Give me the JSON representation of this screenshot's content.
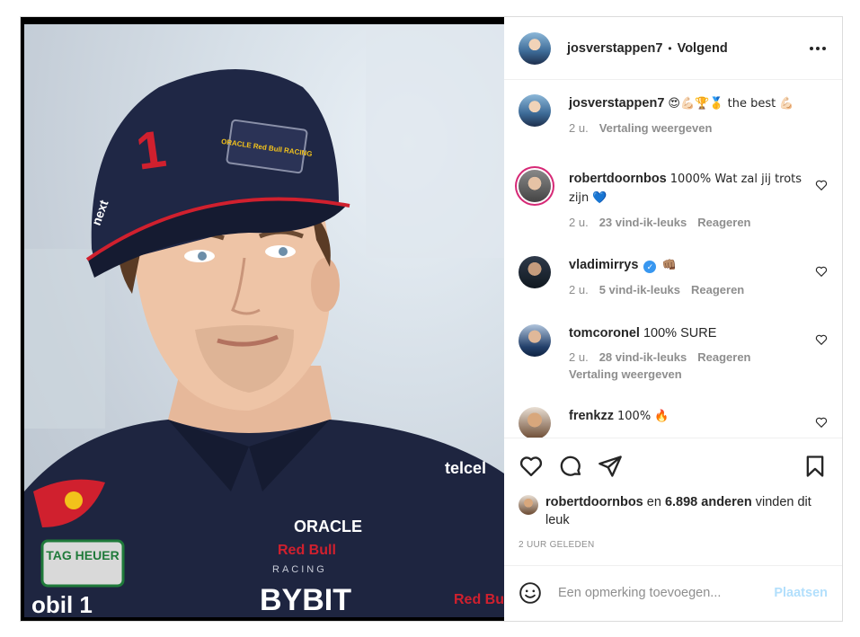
{
  "header": {
    "username": "josverstappen7",
    "separator": "•",
    "follow_label": "Volgend"
  },
  "caption": {
    "username": "josverstappen7",
    "text": "😍💪🏻🏆🥇 the best 💪🏻",
    "time": "2 u.",
    "translate": "Vertaling weergeven"
  },
  "comments": [
    {
      "username": "robertdoornbos",
      "text": "1000% Wat zal jij trots zijn 💙",
      "time": "2 u.",
      "likes": "23 vind-ik-leuks",
      "reply": "Reageren"
    },
    {
      "username": "vladimirrys",
      "verified": "✓",
      "text": "👊🏽",
      "time": "2 u.",
      "likes": "5 vind-ik-leuks",
      "reply": "Reageren"
    },
    {
      "username": "tomcoronel",
      "text": "100% SURE",
      "time": "2 u.",
      "likes": "28 vind-ik-leuks",
      "reply": "Reageren",
      "translate": "Vertaling weergeven"
    },
    {
      "username": "frenkzz",
      "text": "100% 🔥"
    }
  ],
  "likes": {
    "user": "robertdoornbos",
    "connector": "en",
    "count": "6.898 anderen",
    "suffix": "vinden dit leuk"
  },
  "timestamp": "2 UUR GELEDEN",
  "add_comment": {
    "placeholder": "Een opmerking toevoegen...",
    "post_label": "Plaatsen"
  },
  "photo": {
    "cap_number": "1",
    "cap_brand": "ORACLE Red Bull RACING",
    "cap_side": "next",
    "shirt_sponsor": "BYBIT",
    "shirt_oracle": "ORACLE",
    "shirt_redbull": "Red Bull",
    "shirt_racing": "RACING",
    "tag_heuer": "TAG HEUER",
    "mobil": "obil 1",
    "telcel": "telcel",
    "redbull_side": "Red Bull"
  },
  "colors": {
    "text": "#262626",
    "muted": "#8e8e8e",
    "border": "#dbdbdb",
    "post_disabled": "#b2dffc",
    "verified": "#3897f0",
    "navy": "#1e2540",
    "redbull_red": "#d0202e",
    "redbull_yellow": "#f2c21b"
  }
}
